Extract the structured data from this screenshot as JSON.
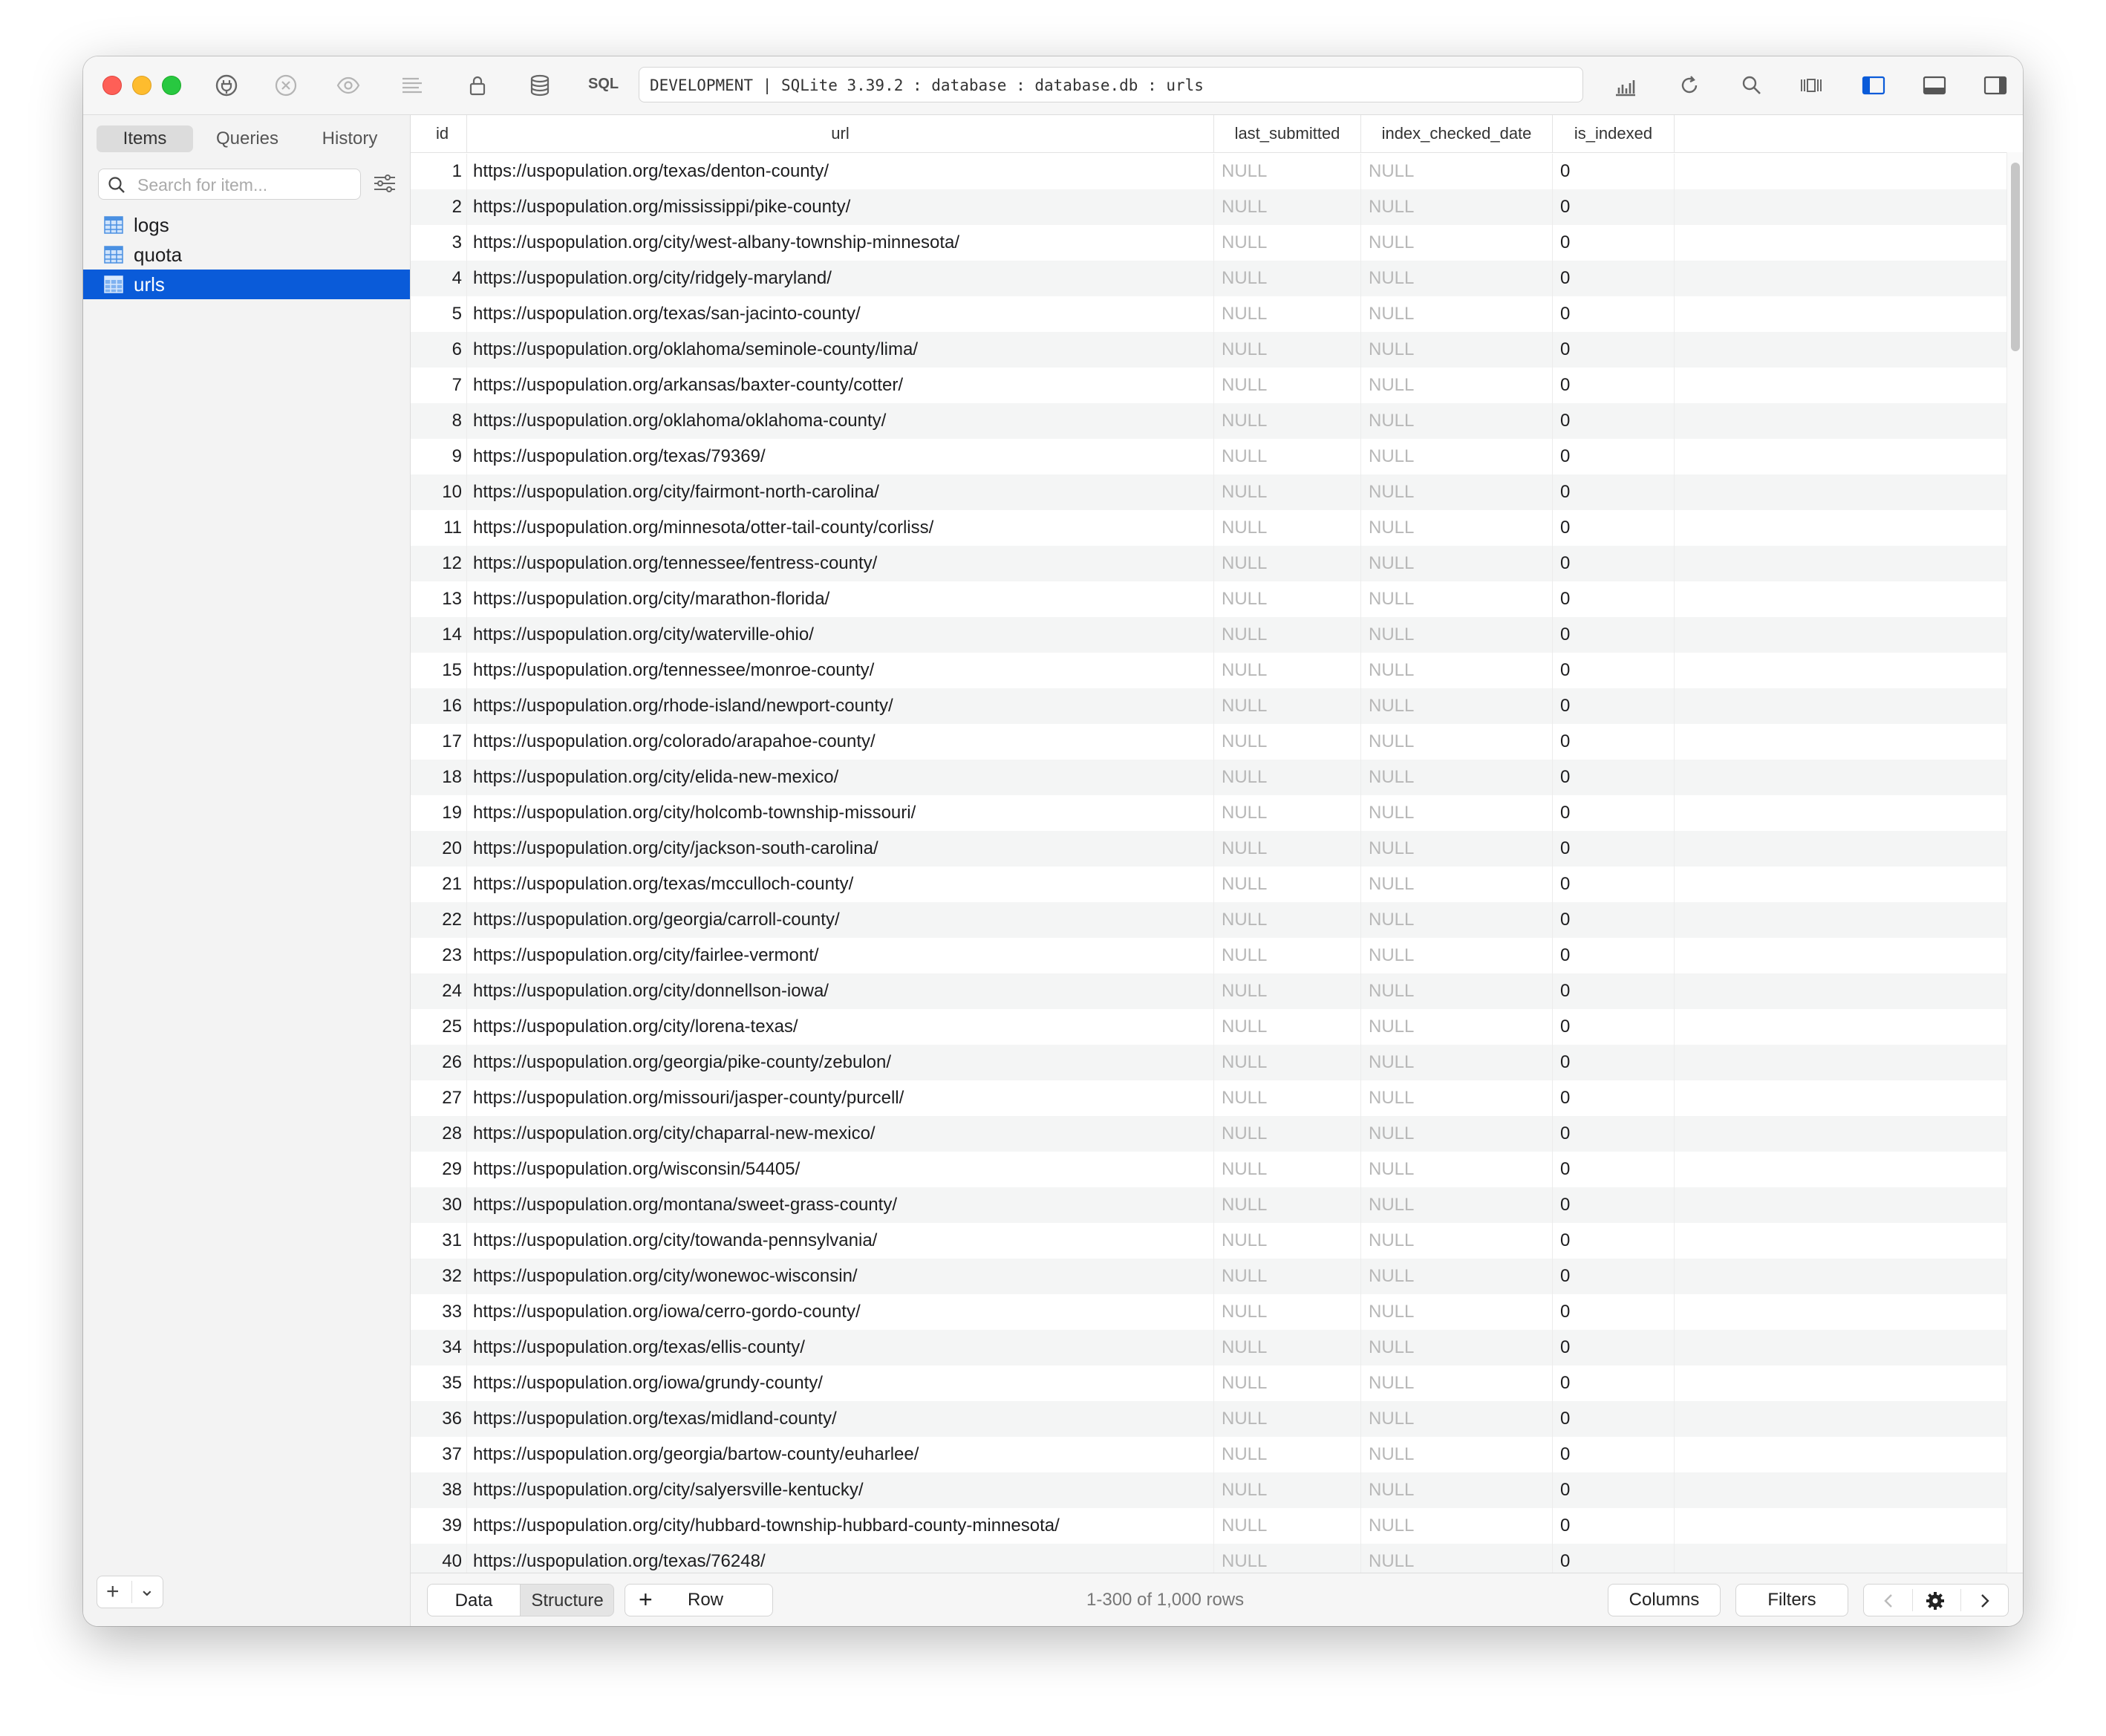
{
  "toolbar": {
    "sql_label": "SQL",
    "address": "DEVELOPMENT | SQLite 3.39.2 : database : database.db : urls"
  },
  "sidebar": {
    "tabs": [
      "Items",
      "Queries",
      "History"
    ],
    "active_tab": "Items",
    "search_placeholder": "Search for item...",
    "tables": [
      {
        "label": "logs",
        "selected": false
      },
      {
        "label": "quota",
        "selected": false
      },
      {
        "label": "urls",
        "selected": true
      }
    ],
    "footer": {
      "add": "+",
      "more": "⌄"
    }
  },
  "table": {
    "columns": [
      "id",
      "url",
      "last_submitted",
      "index_checked_date",
      "is_indexed"
    ],
    "rows": [
      [
        1,
        "https://uspopulation.org/texas/denton-county/",
        "NULL",
        "NULL",
        "0"
      ],
      [
        2,
        "https://uspopulation.org/mississippi/pike-county/",
        "NULL",
        "NULL",
        "0"
      ],
      [
        3,
        "https://uspopulation.org/city/west-albany-township-minnesota/",
        "NULL",
        "NULL",
        "0"
      ],
      [
        4,
        "https://uspopulation.org/city/ridgely-maryland/",
        "NULL",
        "NULL",
        "0"
      ],
      [
        5,
        "https://uspopulation.org/texas/san-jacinto-county/",
        "NULL",
        "NULL",
        "0"
      ],
      [
        6,
        "https://uspopulation.org/oklahoma/seminole-county/lima/",
        "NULL",
        "NULL",
        "0"
      ],
      [
        7,
        "https://uspopulation.org/arkansas/baxter-county/cotter/",
        "NULL",
        "NULL",
        "0"
      ],
      [
        8,
        "https://uspopulation.org/oklahoma/oklahoma-county/",
        "NULL",
        "NULL",
        "0"
      ],
      [
        9,
        "https://uspopulation.org/texas/79369/",
        "NULL",
        "NULL",
        "0"
      ],
      [
        10,
        "https://uspopulation.org/city/fairmont-north-carolina/",
        "NULL",
        "NULL",
        "0"
      ],
      [
        11,
        "https://uspopulation.org/minnesota/otter-tail-county/corliss/",
        "NULL",
        "NULL",
        "0"
      ],
      [
        12,
        "https://uspopulation.org/tennessee/fentress-county/",
        "NULL",
        "NULL",
        "0"
      ],
      [
        13,
        "https://uspopulation.org/city/marathon-florida/",
        "NULL",
        "NULL",
        "0"
      ],
      [
        14,
        "https://uspopulation.org/city/waterville-ohio/",
        "NULL",
        "NULL",
        "0"
      ],
      [
        15,
        "https://uspopulation.org/tennessee/monroe-county/",
        "NULL",
        "NULL",
        "0"
      ],
      [
        16,
        "https://uspopulation.org/rhode-island/newport-county/",
        "NULL",
        "NULL",
        "0"
      ],
      [
        17,
        "https://uspopulation.org/colorado/arapahoe-county/",
        "NULL",
        "NULL",
        "0"
      ],
      [
        18,
        "https://uspopulation.org/city/elida-new-mexico/",
        "NULL",
        "NULL",
        "0"
      ],
      [
        19,
        "https://uspopulation.org/city/holcomb-township-missouri/",
        "NULL",
        "NULL",
        "0"
      ],
      [
        20,
        "https://uspopulation.org/city/jackson-south-carolina/",
        "NULL",
        "NULL",
        "0"
      ],
      [
        21,
        "https://uspopulation.org/texas/mcculloch-county/",
        "NULL",
        "NULL",
        "0"
      ],
      [
        22,
        "https://uspopulation.org/georgia/carroll-county/",
        "NULL",
        "NULL",
        "0"
      ],
      [
        23,
        "https://uspopulation.org/city/fairlee-vermont/",
        "NULL",
        "NULL",
        "0"
      ],
      [
        24,
        "https://uspopulation.org/city/donnellson-iowa/",
        "NULL",
        "NULL",
        "0"
      ],
      [
        25,
        "https://uspopulation.org/city/lorena-texas/",
        "NULL",
        "NULL",
        "0"
      ],
      [
        26,
        "https://uspopulation.org/georgia/pike-county/zebulon/",
        "NULL",
        "NULL",
        "0"
      ],
      [
        27,
        "https://uspopulation.org/missouri/jasper-county/purcell/",
        "NULL",
        "NULL",
        "0"
      ],
      [
        28,
        "https://uspopulation.org/city/chaparral-new-mexico/",
        "NULL",
        "NULL",
        "0"
      ],
      [
        29,
        "https://uspopulation.org/wisconsin/54405/",
        "NULL",
        "NULL",
        "0"
      ],
      [
        30,
        "https://uspopulation.org/montana/sweet-grass-county/",
        "NULL",
        "NULL",
        "0"
      ],
      [
        31,
        "https://uspopulation.org/city/towanda-pennsylvania/",
        "NULL",
        "NULL",
        "0"
      ],
      [
        32,
        "https://uspopulation.org/city/wonewoc-wisconsin/",
        "NULL",
        "NULL",
        "0"
      ],
      [
        33,
        "https://uspopulation.org/iowa/cerro-gordo-county/",
        "NULL",
        "NULL",
        "0"
      ],
      [
        34,
        "https://uspopulation.org/texas/ellis-county/",
        "NULL",
        "NULL",
        "0"
      ],
      [
        35,
        "https://uspopulation.org/iowa/grundy-county/",
        "NULL",
        "NULL",
        "0"
      ],
      [
        36,
        "https://uspopulation.org/texas/midland-county/",
        "NULL",
        "NULL",
        "0"
      ],
      [
        37,
        "https://uspopulation.org/georgia/bartow-county/euharlee/",
        "NULL",
        "NULL",
        "0"
      ],
      [
        38,
        "https://uspopulation.org/city/salyersville-kentucky/",
        "NULL",
        "NULL",
        "0"
      ],
      [
        39,
        "https://uspopulation.org/city/hubbard-township-hubbard-county-minnesota/",
        "NULL",
        "NULL",
        "0"
      ],
      [
        40,
        "https://uspopulation.org/texas/76248/",
        "NULL",
        "NULL",
        "0"
      ]
    ]
  },
  "bottombar": {
    "view_tabs": [
      "Data",
      "Structure"
    ],
    "active_view": "Data",
    "add_row_label": "Row",
    "add_row_icon": "+",
    "row_count": "1-300 of 1,000 rows",
    "columns_label": "Columns",
    "filters_label": "Filters"
  },
  "colors": {
    "selection": "#0a5bd9",
    "null_text": "#b8b8b8",
    "alt_row": "#f4f5f5"
  },
  "icons": [
    "plug-icon",
    "close-circle-icon",
    "eye-icon",
    "text-list-icon",
    "lock-icon",
    "database-icon",
    "chart-icon",
    "refresh-icon",
    "search-icon",
    "columns-icon",
    "sidebar-left-icon",
    "panel-bottom-icon",
    "sidebar-right-icon",
    "filter-settings-icon",
    "gear-icon",
    "chevron-left-icon",
    "chevron-right-icon",
    "table-icon"
  ]
}
